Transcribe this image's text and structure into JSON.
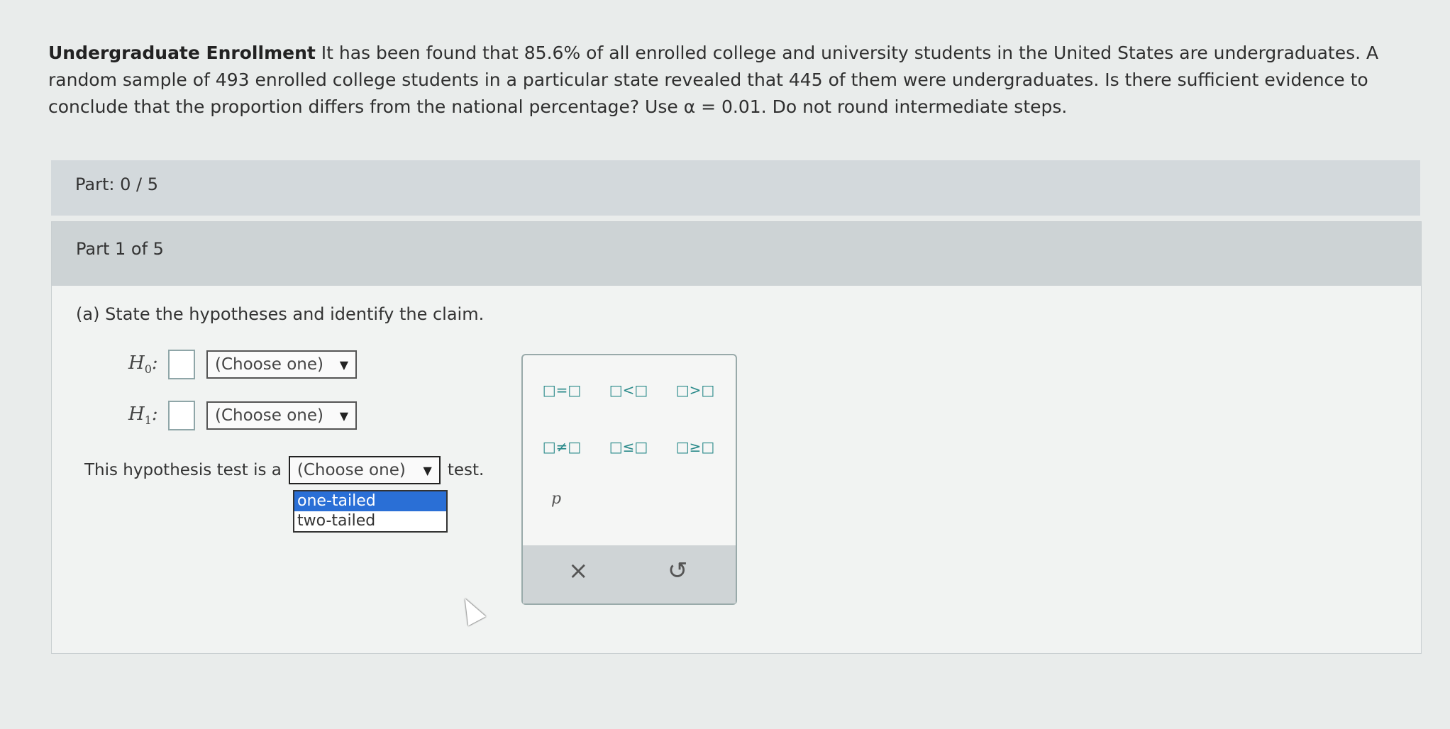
{
  "problem": {
    "title": "Undergraduate Enrollment",
    "text_1": " It has been found that ",
    "pct": "85.6%",
    "text_2": " of all enrolled college and university students in the United States are undergraduates. A random sample of ",
    "sample": "493",
    "text_3": " enrolled college students in a particular state revealed that ",
    "count": "445",
    "text_4": " of them were undergraduates. Is there sufficient evidence to conclude that the proportion differs from the national percentage? Use ",
    "alpha": "α = 0.01",
    "text_5": ". Do not round intermediate steps."
  },
  "progress": {
    "label": "Part: 0 / 5"
  },
  "part": {
    "header": "Part 1 of 5",
    "question": "(a) State the hypotheses and identify the claim."
  },
  "hypotheses": {
    "h0_label": "H",
    "h0_sub": "0",
    "h1_label": "H",
    "h1_sub": "1",
    "select_placeholder": "(Choose one)"
  },
  "test_sentence": {
    "prefix": "This hypothesis test is a",
    "select_value": "(Choose one)",
    "suffix": "test.",
    "options": [
      "one-tailed",
      "two-tailed"
    ],
    "highlighted": "one-tailed"
  },
  "palette": {
    "buttons": [
      "□=□",
      "□<□",
      "□>□",
      "□≠□",
      "□≤□",
      "□≥□"
    ],
    "variable": "p",
    "clear": "×",
    "undo": "↺"
  }
}
